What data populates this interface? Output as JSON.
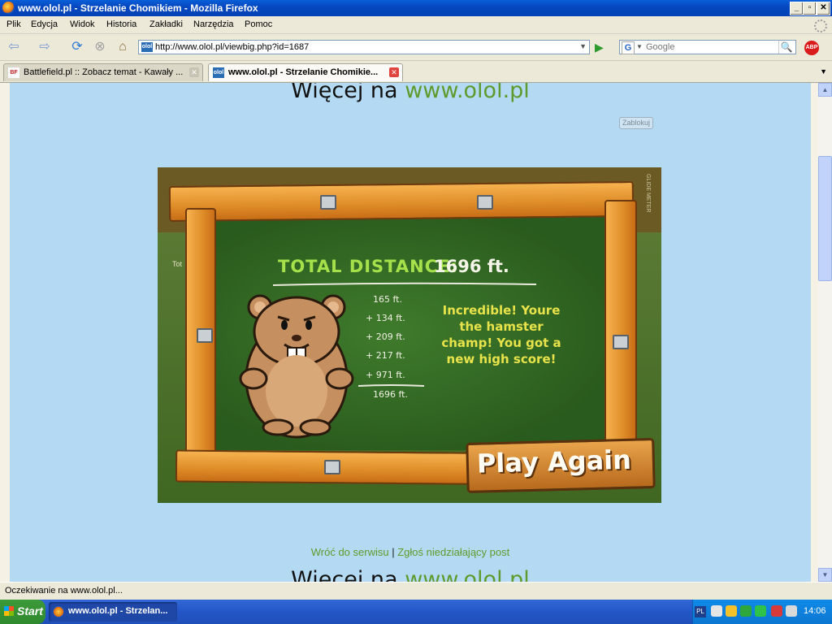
{
  "window": {
    "title": "www.olol.pl - Strzelanie Chomikiem - Mozilla Firefox"
  },
  "menu": [
    "Plik",
    "Edycja",
    "Widok",
    "Historia",
    "Zakładki",
    "Narzędzia",
    "Pomoc"
  ],
  "nav": {
    "url": "http://www.olol.pl/viewbig.php?id=1687",
    "search_placeholder": "Google"
  },
  "tabs": [
    {
      "label": "Battlefield.pl :: Zobacz temat - Kawały ...",
      "active": false
    },
    {
      "label": "www.olol.pl - Strzelanie Chomikie...",
      "active": true
    }
  ],
  "page": {
    "more_prefix": "Więcej na",
    "more_url": "www.olol.pl",
    "block_label": "Zablokuj",
    "back_link": "Wróć do serwisu",
    "separator": "|",
    "report_link": "Zgłoś niedziałający post"
  },
  "game": {
    "total_label": "TOTAL DISTANCE:",
    "total_value": "1696 ft.",
    "distances": [
      "165 ft.",
      "+ 134 ft.",
      "+ 209 ft.",
      "+ 217 ft.",
      "+ 971 ft.",
      "1696 ft."
    ],
    "message": "Incredible!  Youre the hamster champ! You got a new high score!",
    "play_again": "Play Again",
    "side_label": "GLIDE METER",
    "partial_text": "Tot"
  },
  "status": {
    "text": "Oczekiwanie na www.olol.pl..."
  },
  "taskbar": {
    "start": "Start",
    "window_item": "www.olol.pl - Strzelan...",
    "lang": "PL",
    "clock": "14:06"
  },
  "colors": {
    "page_bg": "#b3daf2",
    "link_green": "#5e9a2c",
    "chalk_green": "#a6e04a",
    "chalk_yellow": "#e8e34a",
    "board_green": "#2f6223"
  }
}
